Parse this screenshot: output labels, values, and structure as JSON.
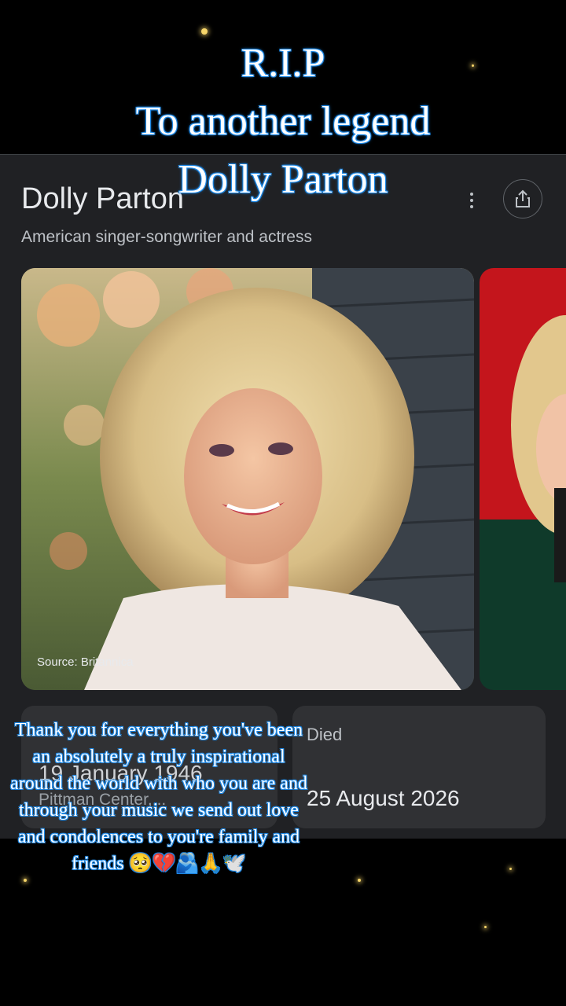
{
  "overlay": {
    "title_lines": [
      "R.I.P",
      "To another legend",
      "Dolly Parton"
    ],
    "message": "Thank you for everything you've been an absolutely a truly inspirational around the world with who you are and through your music we send out love and condolences to you're family and friends 🥺💔🫂🙏🕊️",
    "text_color": "#ffffff",
    "outline_color": "#1e88e5"
  },
  "knowledge_panel": {
    "title": "Dolly Parton",
    "subtitle": "American singer-songwriter and actress",
    "menu_icon": "more-vert-icon",
    "share_icon": "share-icon",
    "image_source": "Source: Britannica",
    "born": {
      "value": "19 January 1946",
      "place": "Pittman Center,..."
    },
    "died": {
      "label": "Died",
      "value": "25 August 2026"
    },
    "colors": {
      "panel_bg": "#202124",
      "card_bg": "#303134",
      "primary_text": "#e8eaed",
      "secondary_text": "#bdc1c6"
    }
  }
}
